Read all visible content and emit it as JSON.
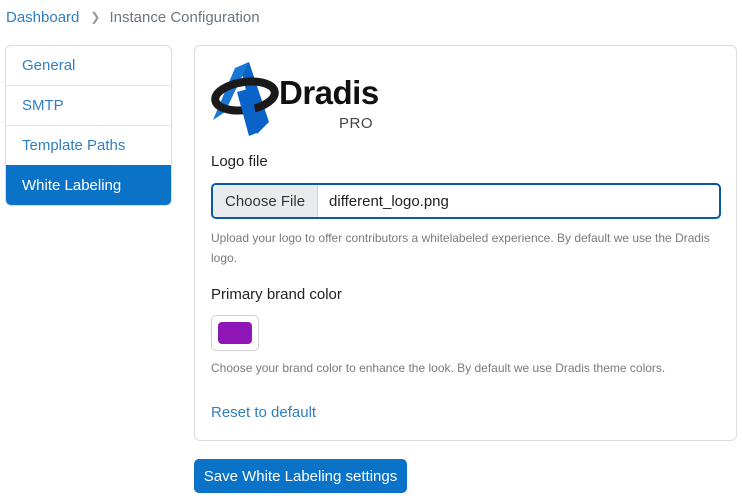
{
  "breadcrumb": {
    "items": [
      "Dashboard",
      "Instance Configuration"
    ],
    "separator_icon": "chevron-right-icon"
  },
  "sidebar": {
    "items": [
      {
        "label": "General",
        "active": false
      },
      {
        "label": "SMTP",
        "active": false
      },
      {
        "label": "Template Paths",
        "active": false
      },
      {
        "label": "White Labeling",
        "active": true
      }
    ]
  },
  "logo": {
    "word": "Dradis",
    "suffix": "PRO"
  },
  "logo_file": {
    "label": "Logo file",
    "button_label": "Choose File",
    "file_name": "different_logo.png",
    "help": "Upload your logo to offer contributors a whitelabeled experience. By default we use the Dradis logo."
  },
  "brand_color": {
    "label": "Primary brand color",
    "value": "#9016b7",
    "help": "Choose your brand color to enhance the look. By default we use Dradis theme colors."
  },
  "reset_label": "Reset to default",
  "save_label": "Save White Labeling settings",
  "colors": {
    "accent": "#0a72c7",
    "link": "#2f7fc1"
  }
}
